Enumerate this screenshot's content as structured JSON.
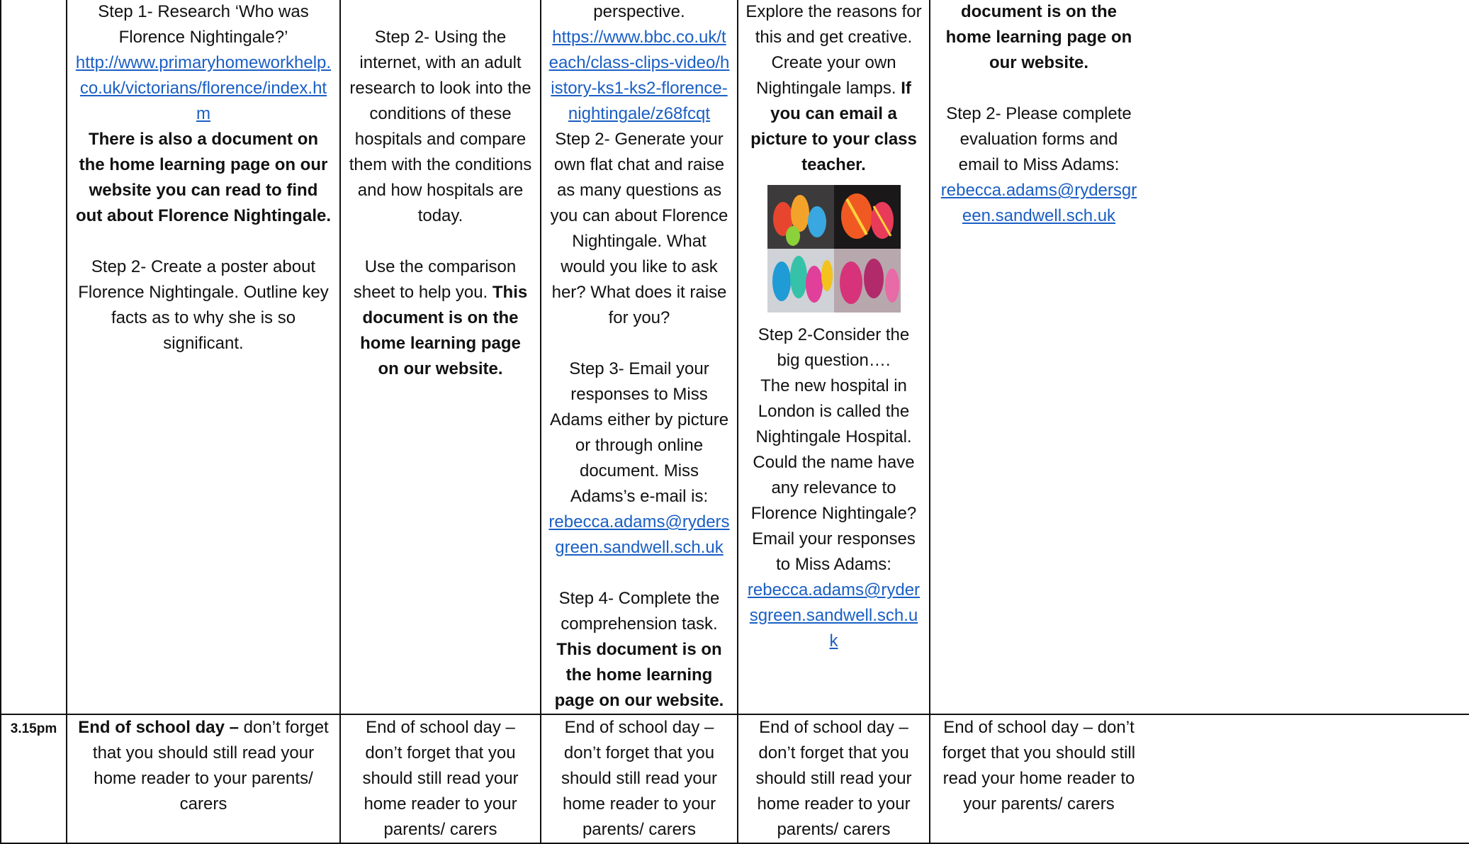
{
  "col1": {
    "step1": "Step 1- Research ‘Who was Florence Nightingale?’",
    "link": "http://www.primaryhomeworkhelp.co.uk/victorians/florence/index.htm",
    "bold_note": "There is also a document on the home learning page on our website you can read to find out about Florence Nightingale.",
    "step2": "Step 2- Create a poster about Florence Nightingale. Outline key facts as to why she is so significant."
  },
  "col2": {
    "step2": "Step 2- Using the internet, with an adult research to look into the conditions of these hospitals and compare them with the conditions and how hospitals are today.",
    "comparison_text": "Use the comparison sheet to help you.",
    "comparison_bold": "This document is on the home learning page on our website."
  },
  "col3": {
    "perspective": "perspective.",
    "link": "https://www.bbc.co.uk/teach/class-clips-video/history-ks1-ks2-florence-nightingale/z68fcqt",
    "step2": "Step 2- Generate your own flat chat and raise as many questions as you can about Florence Nightingale. What would you like to ask her? What does it raise for you?",
    "step3": "Step 3- Email your responses to Miss Adams either by picture or through online document. Miss Adams’s e-mail is:",
    "email": "rebecca.adams@rydersgreen.sandwell.sch.uk",
    "step4_text": "Step 4- Complete the comprehension task.",
    "step4_bold": "This document is on the home learning page on our website."
  },
  "col4": {
    "explore": "Explore the reasons for this and get creative. Create your own Nightingale lamps.",
    "explore_bold": "If you can email a picture to your class teacher.",
    "image_icon": "paper-lanterns-photo",
    "step2": "Step 2-Consider the big question….",
    "hospital": "The new hospital in London is called the Nightingale Hospital.",
    "question": "Could the name have any relevance to Florence Nightingale?",
    "email_prompt": "Email your responses to Miss Adams:",
    "email": "rebecca.adams@rydersgreen.sandwell.sch.uk"
  },
  "col5": {
    "top_bold": "document is on the home learning page on our website.",
    "step2": "Step 2- Please complete evaluation forms and email to Miss Adams:",
    "email": "rebecca.adams@rydersgreen.sandwell.sch.uk"
  },
  "row2": {
    "time": "3.15pm",
    "col1_bold": "End of school day –",
    "col1_rest": " don’t forget that you should still read your home reader to your parents/ carers",
    "end_text": "End of school day – don’t forget that you should still read your home reader to your parents/ carers"
  },
  "colors": {
    "link": "#1a5fc4",
    "border": "#111111"
  }
}
